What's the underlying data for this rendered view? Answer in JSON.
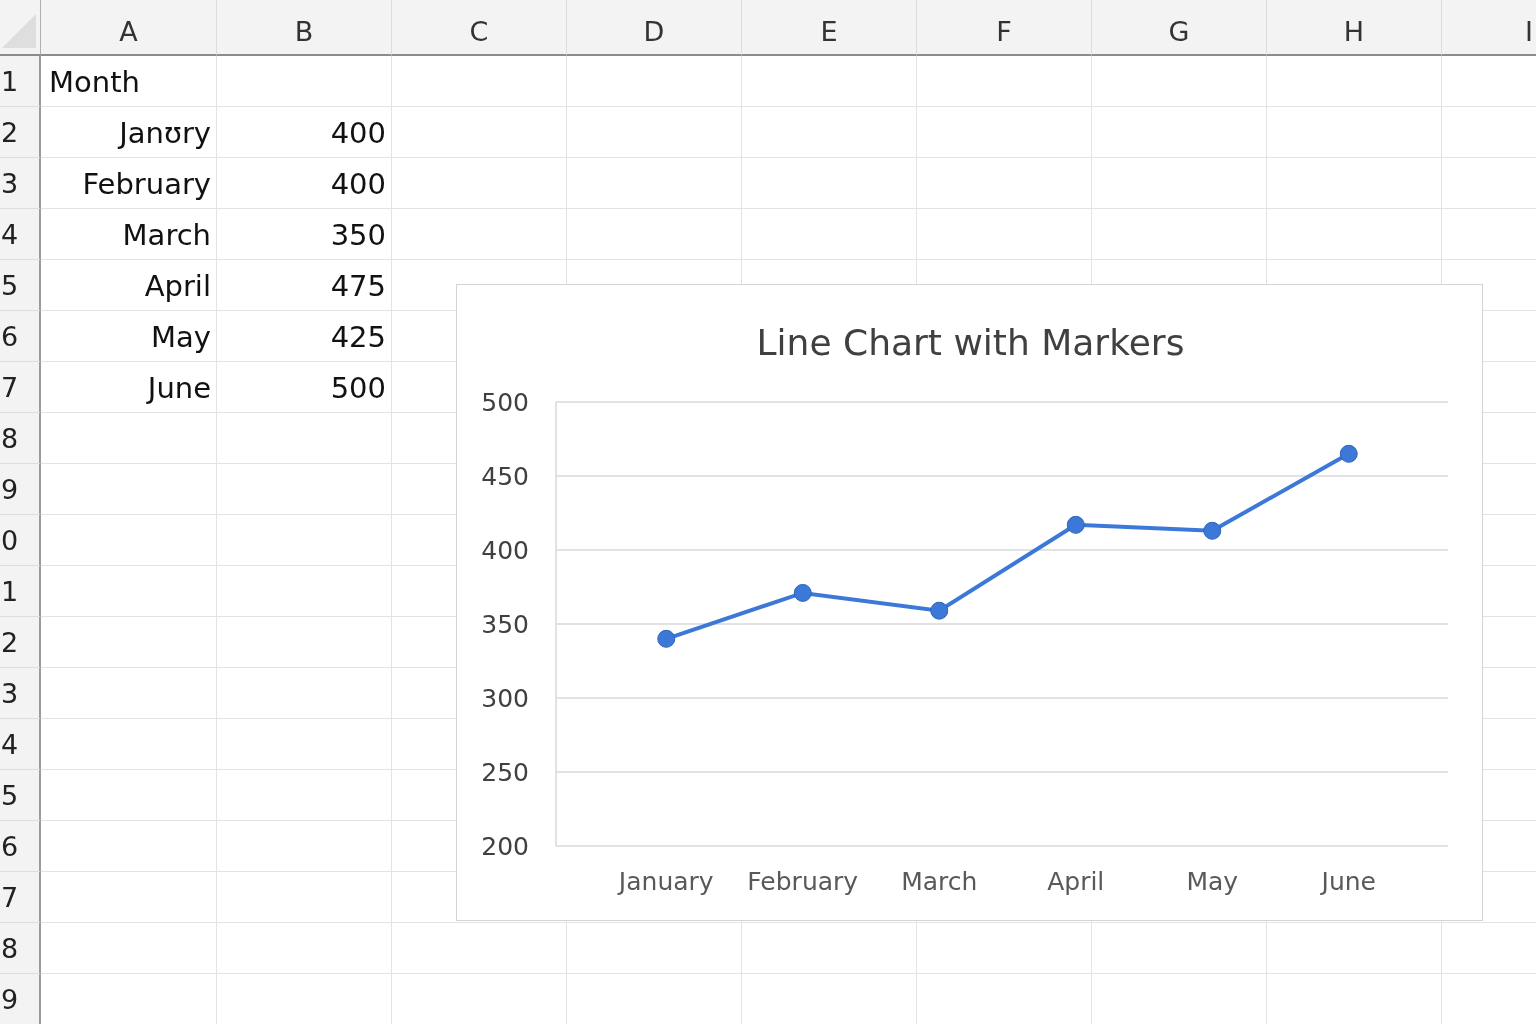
{
  "columns": [
    "A",
    "B",
    "C",
    "D",
    "E",
    "F",
    "G",
    "H",
    "I"
  ],
  "rows": [
    {
      "number": "1",
      "cells": [
        {
          "text": "Month",
          "kind": "label"
        }
      ]
    },
    {
      "number": "2",
      "cells": [
        {
          "text": "Janʊry",
          "kind": "value"
        },
        {
          "text": "400",
          "kind": "value"
        }
      ]
    },
    {
      "number": "3",
      "cells": [
        {
          "text": "February",
          "kind": "value"
        },
        {
          "text": "400",
          "kind": "value"
        }
      ]
    },
    {
      "number": "4",
      "cells": [
        {
          "text": "March",
          "kind": "value"
        },
        {
          "text": "350",
          "kind": "value"
        }
      ]
    },
    {
      "number": "5",
      "cells": [
        {
          "text": "April",
          "kind": "value"
        },
        {
          "text": "475",
          "kind": "value"
        }
      ]
    },
    {
      "number": "6",
      "cells": [
        {
          "text": "May",
          "kind": "value"
        },
        {
          "text": "425",
          "kind": "value"
        }
      ]
    },
    {
      "number": "7",
      "cells": [
        {
          "text": "June",
          "kind": "value"
        },
        {
          "text": "500",
          "kind": "value"
        }
      ]
    },
    {
      "number": "8"
    },
    {
      "number": "9"
    },
    {
      "number": "0"
    },
    {
      "number": "1"
    },
    {
      "number": "2"
    },
    {
      "number": "3"
    },
    {
      "number": "4"
    },
    {
      "number": "5"
    },
    {
      "number": "6"
    },
    {
      "number": "7"
    },
    {
      "number": "8"
    },
    {
      "number": "9"
    }
  ],
  "chart": {
    "chart_data": {
      "type": "line",
      "title": "Line Chart with Markers",
      "categories": [
        "January",
        "February",
        "March",
        "April",
        "May",
        "June"
      ],
      "series": [
        {
          "color": "#3b78d8",
          "marker": "circle",
          "values": [
            340,
            371,
            359,
            417,
            413,
            465
          ]
        }
      ],
      "ylim": [
        200,
        500
      ],
      "yticks": [
        200,
        250,
        300,
        350,
        400,
        450,
        500
      ],
      "grid": true
    }
  }
}
